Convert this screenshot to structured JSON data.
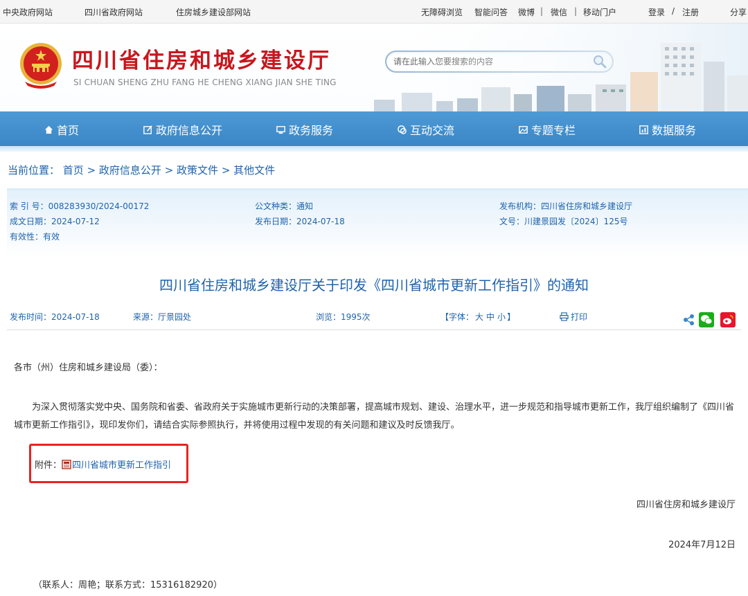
{
  "topbar": {
    "left_links": [
      "中央政府网站",
      "四川省政府网站",
      "住房城乡建设部网站"
    ],
    "right_links": [
      "无障碍浏览",
      "智能问答",
      "微博",
      "微信",
      "移动门户"
    ],
    "login": "登录",
    "slash": "/",
    "register": "注册",
    "share": "分享",
    "sep": "|"
  },
  "header": {
    "title": "四川省住房和城乡建设厅",
    "subtitle": "SI CHUAN SHENG ZHU FANG HE CHENG XIANG JIAN SHE TING",
    "search_placeholder": "请在此输入您要搜索的内容"
  },
  "nav": {
    "items": [
      "首页",
      "政府信息公开",
      "政务服务",
      "互动交流",
      "专题专栏",
      "数据服务"
    ]
  },
  "breadcrumb": {
    "prefix": "当前位置：",
    "items": [
      "首页",
      "政府信息公开",
      "政策文件",
      "其他文件"
    ],
    "sep": " > "
  },
  "info": {
    "index_label": "索 引 号：",
    "index_value": "008283930/2024-00172",
    "type_label": "公文种类：",
    "type_value": "通知",
    "org_label": "发布机构：",
    "org_value": "四川省住房和城乡建设厅",
    "created_label": "成文日期：",
    "created_value": "2024-07-12",
    "published_label": "发布日期：",
    "published_value": "2024-07-18",
    "docno_label": "文号：",
    "docno_value": "川建景园发〔2024〕125号",
    "valid_label": "有效性：",
    "valid_value": "有效"
  },
  "article": {
    "title": "四川省住房和城乡建设厅关于印发《四川省城市更新工作指引》的通知",
    "pubtime_label": "发布时间：",
    "pubtime_value": "2024-07-18",
    "source_label": "来源：",
    "source_value": "厅景园处",
    "views_label": "浏览：",
    "views_value": "1995次",
    "font_open": "【字体：",
    "font_big": "大",
    "font_mid": "中",
    "font_small": "小",
    "font_close": "】",
    "print": "打印",
    "salutation": "各市（州）住房和城乡建设局（委）：",
    "body": "为深入贯彻落实党中央、国务院和省委、省政府关于实施城市更新行动的决策部署，提高城市规划、建设、治理水平，进一步规范和指导城市更新工作，我厅组织编制了《四川省城市更新工作指引》，现印发你们，请结合实际参照执行，并将使用过程中发现的有关问题和建议及时反馈我厅。",
    "attachment_label": "附件：",
    "attachment_link": "四川省城市更新工作指引",
    "signature": "四川省住房和城乡建设厅",
    "date": "2024年7月12日",
    "contact": "（联系人：周艳；联系方式：15316182920）"
  },
  "colors": {
    "brand_red": "#c8161d",
    "nav_blue": "#3b86c6",
    "link_blue": "#1e63ad",
    "highlight_red": "#e8231f",
    "wechat_green": "#1aad19",
    "weibo_red": "#e6162d"
  },
  "icons": [
    "emblem-icon",
    "search-icon",
    "home-icon",
    "edit-icon",
    "monitor-icon",
    "chat-icon",
    "image-icon",
    "chart-icon",
    "printer-icon",
    "share-icon",
    "wechat-icon",
    "weibo-icon",
    "pdf-icon"
  ]
}
